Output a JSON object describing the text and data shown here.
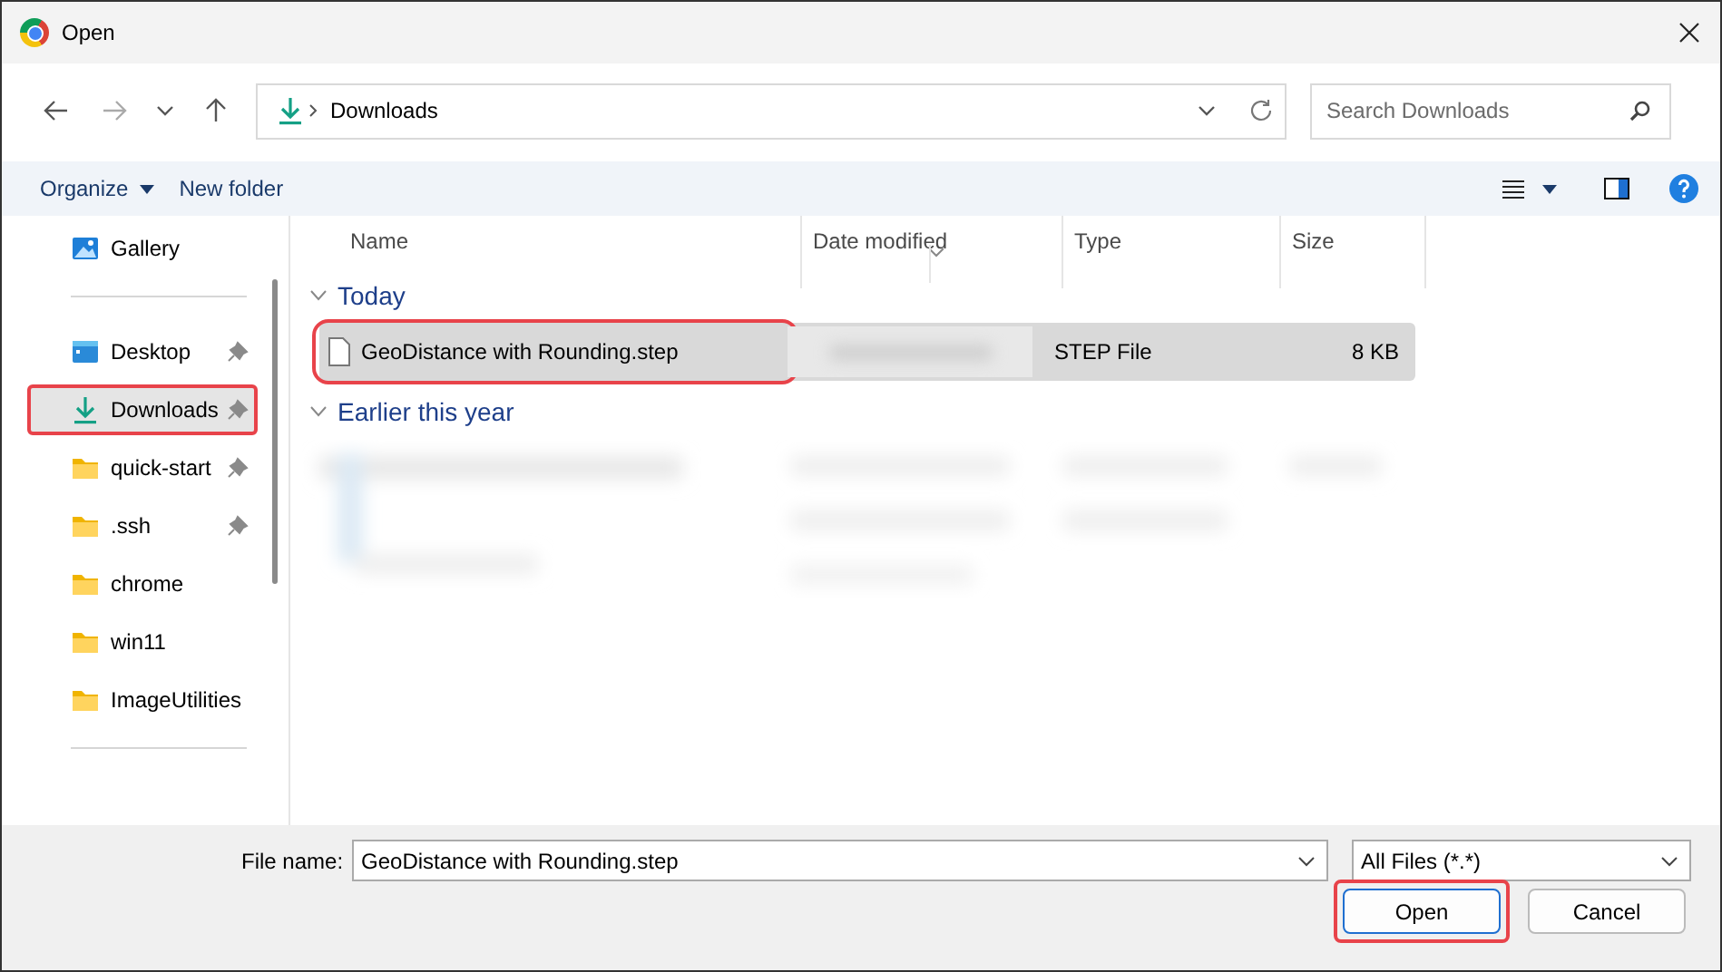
{
  "window": {
    "title": "Open"
  },
  "address": {
    "path": "Downloads"
  },
  "search": {
    "placeholder": "Search Downloads"
  },
  "commands": [
    {
      "label": "Organize",
      "kind": "menu"
    },
    {
      "label": "New folder",
      "kind": "button"
    }
  ],
  "nav": {
    "sections": [
      {
        "items": [
          {
            "label": "Gallery",
            "kind": "gallery",
            "pinned": false,
            "selected": false,
            "highlighted": false
          }
        ]
      },
      {
        "items": [
          {
            "label": "Desktop",
            "kind": "desktop",
            "pinned": true,
            "selected": false,
            "highlighted": false
          },
          {
            "label": "Downloads",
            "kind": "download",
            "pinned": true,
            "selected": true,
            "highlighted": true
          },
          {
            "label": "quick-start",
            "kind": "folder",
            "pinned": true,
            "selected": false,
            "highlighted": false
          },
          {
            "label": ".ssh",
            "kind": "folder",
            "pinned": true,
            "selected": false,
            "highlighted": false
          },
          {
            "label": "chrome",
            "kind": "folder",
            "pinned": false,
            "selected": false,
            "highlighted": false
          },
          {
            "label": "win11",
            "kind": "folder",
            "pinned": false,
            "selected": false,
            "highlighted": false
          },
          {
            "label": "ImageUtilities",
            "kind": "folder",
            "pinned": false,
            "selected": false,
            "highlighted": false
          }
        ]
      }
    ]
  },
  "table": {
    "columns": [
      "Name",
      "Date modified",
      "Type",
      "Size"
    ],
    "groups": [
      {
        "label": "Today",
        "expanded": true,
        "blurred": false,
        "files": [
          {
            "name": "GeoDistance with Rounding.step",
            "date_blurred": true,
            "type": "STEP File",
            "size": "8 KB",
            "selected": true,
            "highlighted": true
          }
        ]
      },
      {
        "label": "Earlier this year",
        "expanded": true,
        "blurred": true
      }
    ]
  },
  "footer": {
    "file_name_label": "File name:",
    "file_name": "GeoDistance with Rounding.step",
    "filter": "All Files (*.*)",
    "buttons": [
      {
        "label": "Open",
        "default": true,
        "highlighted": true
      },
      {
        "label": "Cancel",
        "default": false,
        "highlighted": false
      }
    ]
  }
}
